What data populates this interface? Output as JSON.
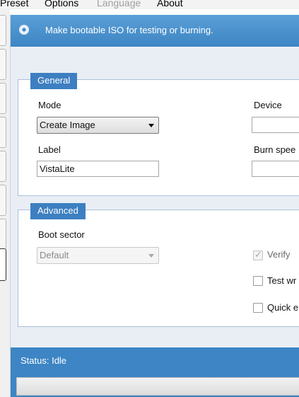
{
  "menu": {
    "preset": "Preset",
    "options": "Options",
    "language": "Language",
    "about": "About"
  },
  "banner": {
    "icon": "disc-icon",
    "text": "Make bootable ISO for testing or burning."
  },
  "general": {
    "title": "General",
    "mode_label": "Mode",
    "mode_value": "Create Image",
    "label_label": "Label",
    "label_value": "VistaLite",
    "device_label": "Device",
    "burn_speed_label": "Burn spee"
  },
  "advanced": {
    "title": "Advanced",
    "boot_sector_label": "Boot sector",
    "boot_sector_value": "Default",
    "verify_label": "Verify",
    "verify_checked": true,
    "test_write_label": "Test wr",
    "test_write_checked": false,
    "quick_erase_label": "Quick e",
    "quick_erase_checked": false
  },
  "status": {
    "text": "Status: Idle"
  },
  "colors": {
    "banner_blue": "#3d85c4",
    "group_header_blue": "#3d7fc1",
    "panel_background": "#e9eef5"
  }
}
